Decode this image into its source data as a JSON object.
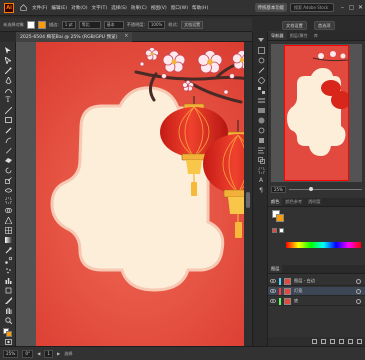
{
  "app": {
    "logo": "Ai"
  },
  "menu": [
    "文件(F)",
    "编辑(E)",
    "对象(O)",
    "文字(T)",
    "选择(S)",
    "效果(C)",
    "视图(V)",
    "窗口(W)",
    "帮助(H)"
  ],
  "topbar": {
    "share_label": "共享",
    "search_placeholder": "搜索 Adobe Stock",
    "extra_label": "传统基本功能"
  },
  "workspace": {
    "btn1": "文档设置",
    "btn2": "首选项"
  },
  "control": {
    "selection_label": "未选择对象",
    "stroke_label": "描边:",
    "stroke_value": "1 pt",
    "style_label": "等比",
    "uniform_label": "基本",
    "opacity_label": "不透明度:",
    "opacity_value": "100%",
    "style2_label": "样式:",
    "doc_btn": "文档设置"
  },
  "document": {
    "tab_title": "2025-6504 梅花Bai @ 25% (RGB/GPU 预览)"
  },
  "status": {
    "zoom": "25%",
    "rotate": "0°",
    "artboard": "1",
    "tool": "选择"
  },
  "panels": {
    "nav_tabs": [
      "导航器",
      "图层/属性",
      "库"
    ],
    "zoom_value": "25%",
    "color_tabs": [
      "颜色",
      "颜色参考",
      "透明度"
    ],
    "layers_title": "图层",
    "layers": [
      {
        "name": "图层 - 白边",
        "color": "#4fd0ff",
        "selected": false
      },
      {
        "name": "灯笼",
        "color": "#ff3c3c",
        "selected": true
      },
      {
        "name": "底",
        "color": "#5aff5a",
        "selected": false
      }
    ]
  },
  "colors": {
    "accent": "#e24a3f",
    "artboard_bg": "#e24a3f",
    "frame": "#fcebd8"
  }
}
